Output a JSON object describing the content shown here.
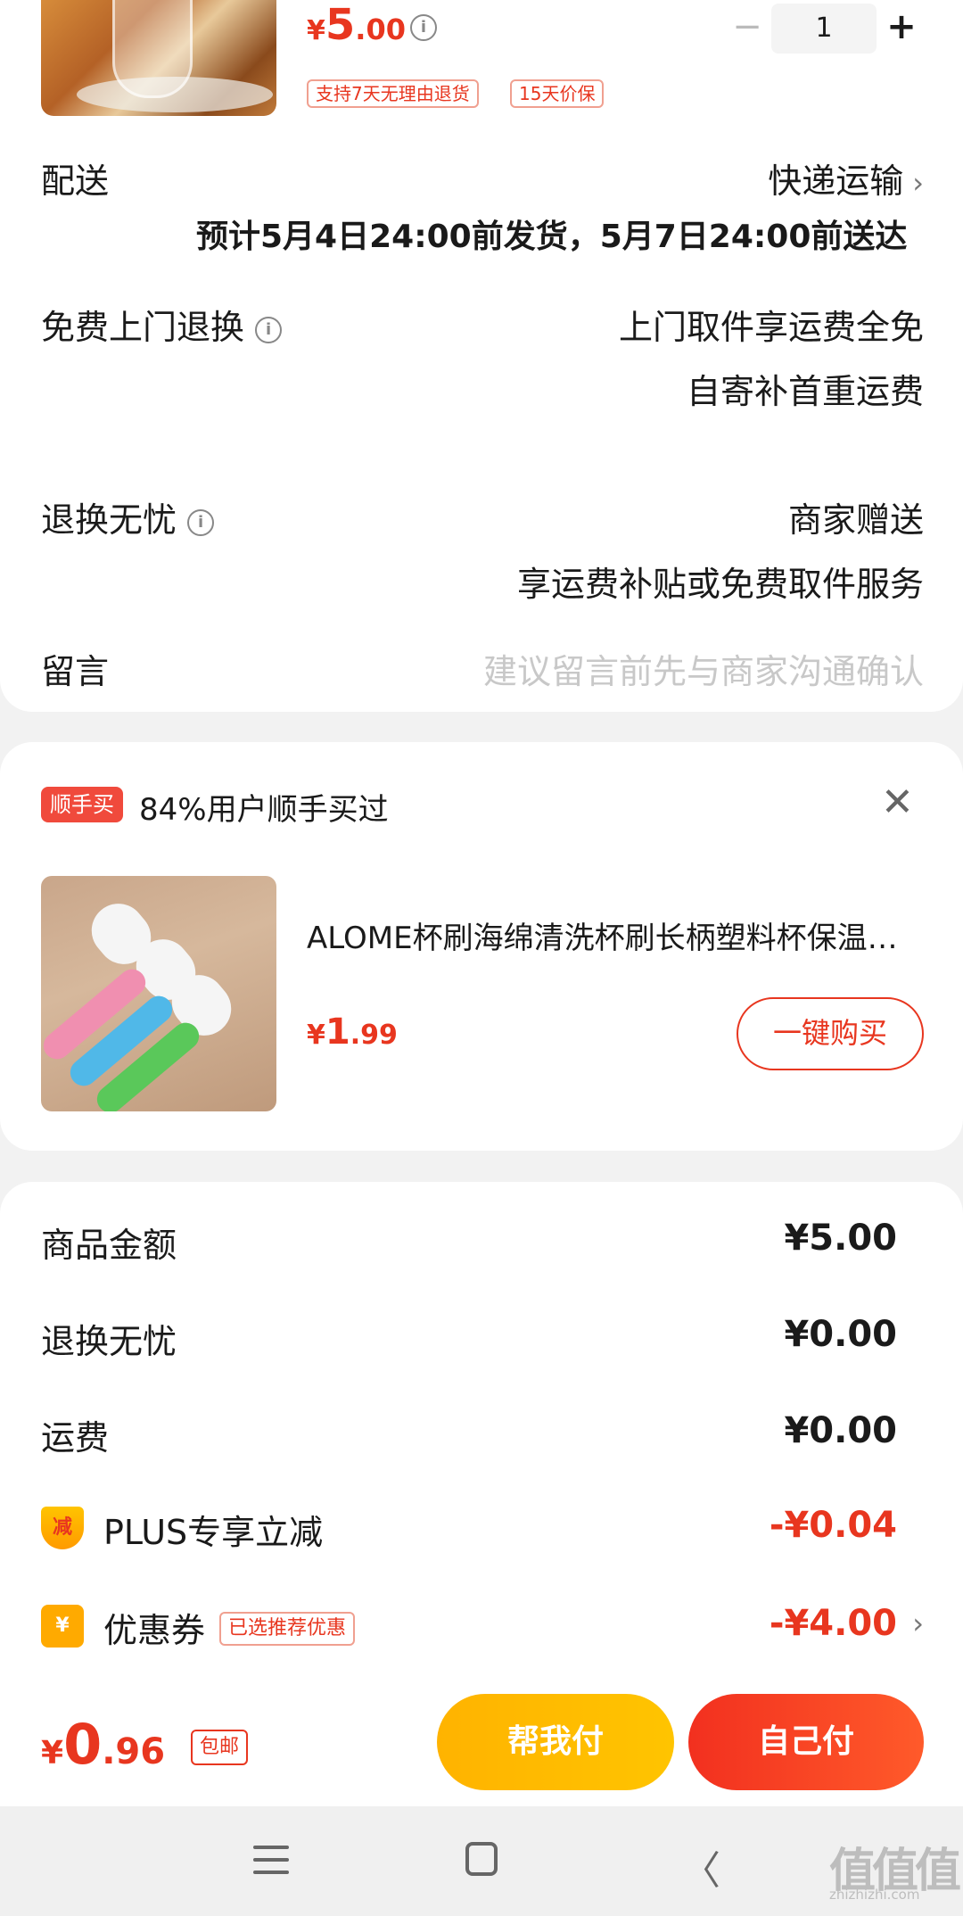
{
  "product": {
    "price_yen": "¥",
    "price_int": "5",
    "price_dec": ".00",
    "tags": [
      "支持7天无理由退货",
      "15天价保"
    ],
    "quantity": "1",
    "minus": "−",
    "plus": "+"
  },
  "delivery": {
    "label": "配送",
    "method": "快递运输",
    "estimate": "预计5月4日24:00前发货，5月7日24:00前送达"
  },
  "free_return": {
    "label": "免费上门退换",
    "line1": "上门取件享运费全免",
    "line2": "自寄补首重运费"
  },
  "worry_free": {
    "label": "退换无忧",
    "line1": "商家赠送",
    "line2": "享运费补贴或免费取件服务"
  },
  "message": {
    "label": "留言",
    "placeholder": "建议留言前先与商家沟通确认"
  },
  "addon": {
    "badge": "顺手买",
    "title": "84%用户顺手买过",
    "name": "ALOME杯刷海绵清洗杯刷长柄塑料杯保温杯刷子",
    "price_yen": "¥",
    "price_int": "1",
    "price_dec": ".99",
    "buy_label": "一键购买"
  },
  "summary": {
    "goods_label": "商品金额",
    "goods_value": "¥5.00",
    "worry_label": "退换无忧",
    "worry_value": "¥0.00",
    "freight_label": "运费",
    "freight_value": "¥0.00",
    "plus_icon": "减",
    "plus_label": "PLUS专享立减",
    "plus_value": "-¥0.04",
    "coupon_icon": "¥",
    "coupon_label": "优惠券",
    "coupon_tag": "已选推荐优惠",
    "coupon_value": "-¥4.00"
  },
  "checkout": {
    "yen": "¥",
    "int": "0",
    "dec": ".96",
    "shipping_tag": "包邮",
    "help_pay": "帮我付",
    "self_pay": "自己付"
  },
  "watermark": {
    "logo": "值值值",
    "site": "zhizhizhi.com"
  },
  "colors": {
    "accent": "#e8361f",
    "help_button": "#ffb300",
    "self_button": "#f2301f"
  }
}
